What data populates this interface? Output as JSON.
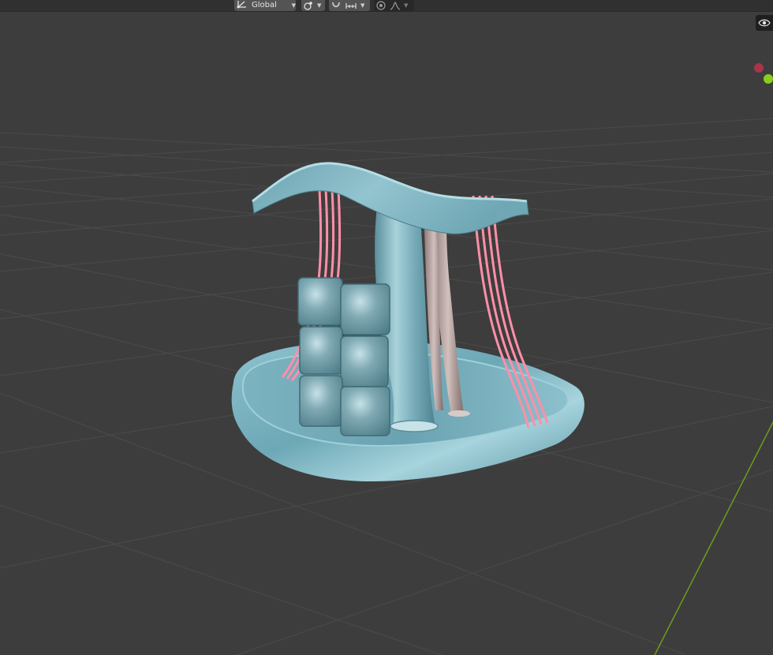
{
  "header": {
    "transform_orientation": {
      "label": "Global",
      "icon": "orientation-icon"
    },
    "pivot_point": {
      "icon": "pivot-icon"
    },
    "snapping": {
      "toggle_icon": "snap-magnet-icon",
      "mode_icon": "snap-increment-icon"
    },
    "proportional_editing": {
      "toggle_icon": "proportional-edit-icon",
      "falloff_icon": "falloff-icon"
    }
  },
  "overlays": {
    "icon": "visibility-eye-icon"
  },
  "gizmo": {
    "x_axis_color": "#a8344a",
    "y_axis_color": "#8bcd1d"
  },
  "scene": {
    "background": "#3d3d3d",
    "grid_color": "#4b4b4b",
    "y_axis_line_color": "#6f9a1f",
    "object": {
      "body_color": "#7fb1bd",
      "ribbon_color": "#ff8fa8",
      "tube_color": "#b39a98"
    }
  }
}
